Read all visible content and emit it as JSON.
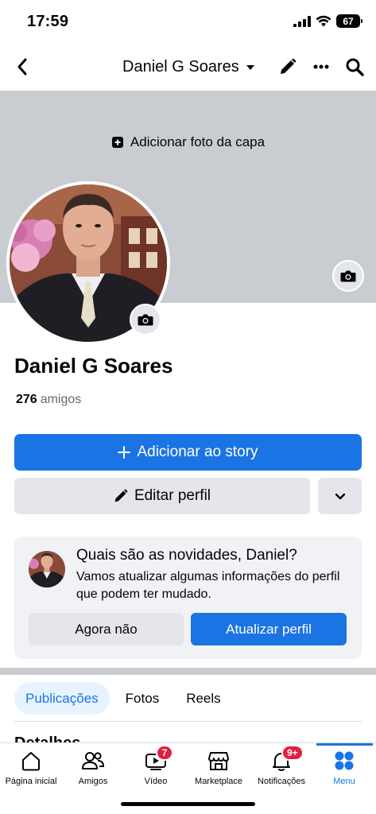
{
  "status_bar": {
    "time": "17:59",
    "battery": "67"
  },
  "header": {
    "title": "Daniel G Soares"
  },
  "cover": {
    "add_cover_label": "Adicionar foto da capa"
  },
  "profile": {
    "name": "Daniel G Soares",
    "friends_count": "276",
    "friends_label": "amigos"
  },
  "actions": {
    "add_story_label": "Adicionar ao story",
    "edit_profile_label": "Editar perfil"
  },
  "update_card": {
    "title": "Quais são as novidades, Daniel?",
    "text": "Vamos atualizar algumas informações do perfil que podem ter mudado.",
    "not_now_label": "Agora não",
    "update_label": "Atualizar perfil"
  },
  "tabs": [
    {
      "label": "Publicações",
      "active": true
    },
    {
      "label": "Fotos",
      "active": false
    },
    {
      "label": "Reels",
      "active": false
    }
  ],
  "partial_section_title": "Detalhes",
  "bottom_nav": [
    {
      "label": "Página inicial",
      "icon": "home-icon"
    },
    {
      "label": "Amigos",
      "icon": "friends-icon"
    },
    {
      "label": "Vídeo",
      "icon": "video-icon",
      "badge": "7"
    },
    {
      "label": "Marketplace",
      "icon": "marketplace-icon"
    },
    {
      "label": "Notificações",
      "icon": "bell-icon",
      "badge": "9+"
    },
    {
      "label": "Menu",
      "icon": "menu-icon",
      "active": true
    }
  ],
  "colors": {
    "primary": "#1b74e4",
    "cover_bg": "#c9ccd1",
    "secondary_button": "#e4e6eb",
    "badge": "#e41e3f"
  }
}
